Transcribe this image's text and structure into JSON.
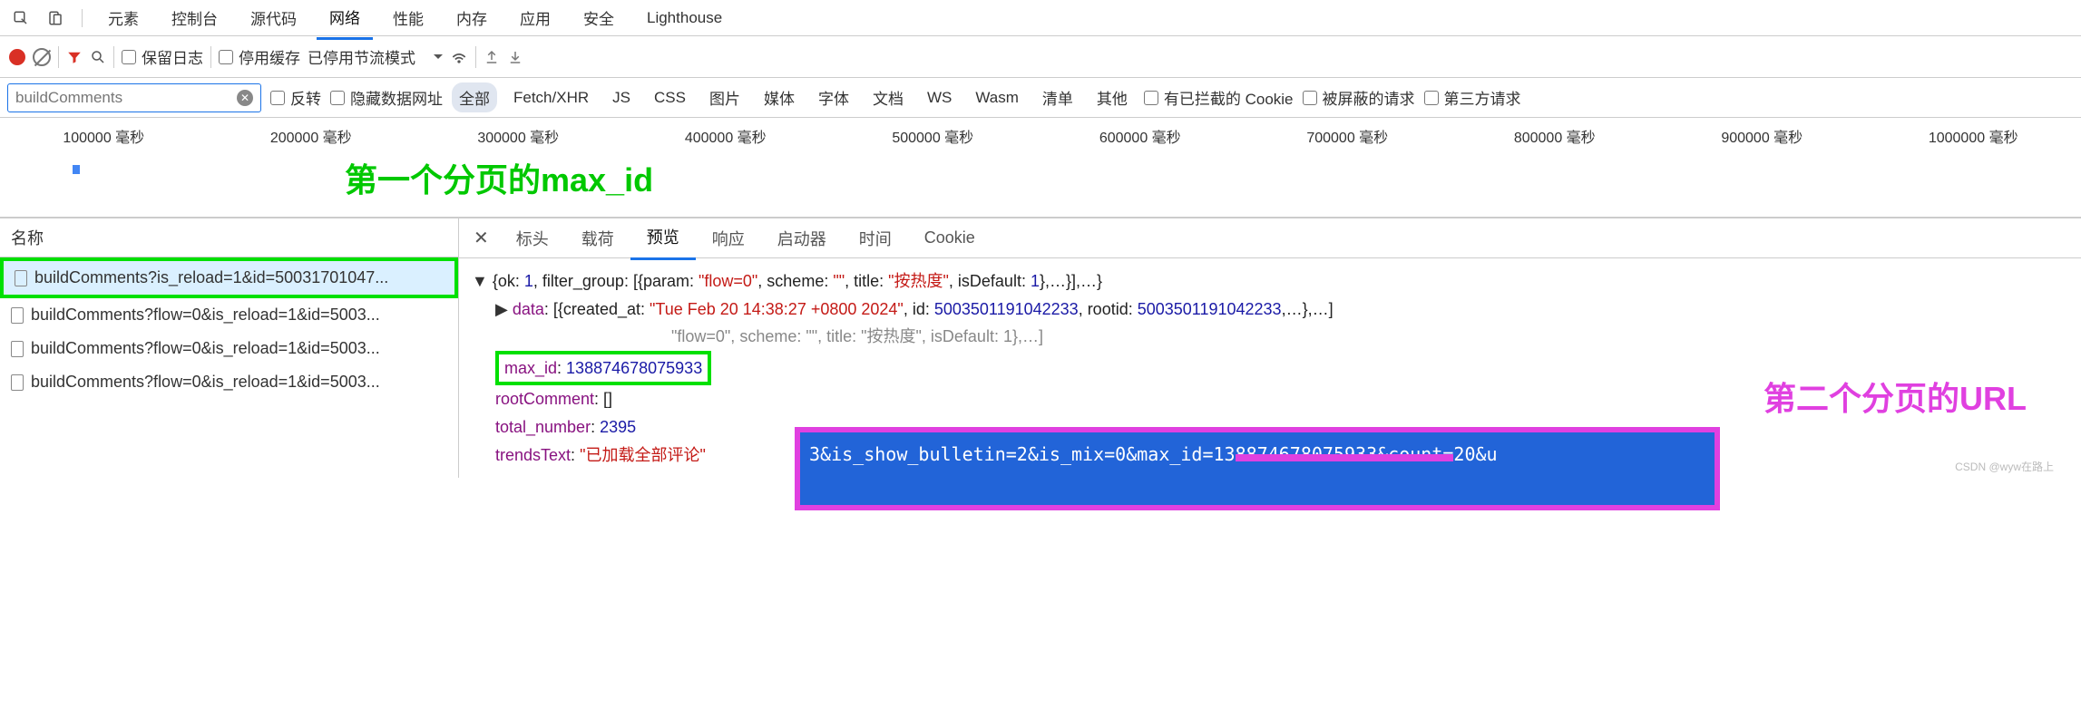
{
  "top_tabs": {
    "elements": "元素",
    "console": "控制台",
    "sources": "源代码",
    "network": "网络",
    "performance": "性能",
    "memory": "内存",
    "application": "应用",
    "security": "安全",
    "lighthouse": "Lighthouse"
  },
  "toolbar": {
    "preserve_log": "保留日志",
    "disable_cache": "停用缓存",
    "throttling": "已停用节流模式"
  },
  "filter_bar": {
    "input_value": "buildComments",
    "invert": "反转",
    "hide_data_urls": "隐藏数据网址",
    "all": "全部",
    "fetch_xhr": "Fetch/XHR",
    "js": "JS",
    "css": "CSS",
    "img": "图片",
    "media": "媒体",
    "font": "字体",
    "doc": "文档",
    "ws": "WS",
    "wasm": "Wasm",
    "manifest": "清单",
    "other": "其他",
    "blocked_cookies": "有已拦截的 Cookie",
    "blocked_requests": "被屏蔽的请求",
    "third_party": "第三方请求"
  },
  "timeline": {
    "labels": [
      "100000 毫秒",
      "200000 毫秒",
      "300000 毫秒",
      "400000 毫秒",
      "500000 毫秒",
      "600000 毫秒",
      "700000 毫秒",
      "800000 毫秒",
      "900000 毫秒",
      "1000000 毫秒"
    ]
  },
  "annotations": {
    "first_page_max_id": "第一个分页的max_id",
    "second_page_url": "第二个分页的URL"
  },
  "left_panel": {
    "name_header": "名称",
    "requests": [
      "buildComments?is_reload=1&id=50031701047...",
      "buildComments?flow=0&is_reload=1&id=5003...",
      "buildComments?flow=0&is_reload=1&id=5003...",
      "buildComments?flow=0&is_reload=1&id=5003..."
    ]
  },
  "detail_tabs": {
    "headers": "标头",
    "payload": "载荷",
    "preview": "预览",
    "response": "响应",
    "initiator": "启动器",
    "timing": "时间",
    "cookie": "Cookie"
  },
  "preview": {
    "line1_pre": "{ok: ",
    "line1_ok": "1",
    "line1_mid": ", filter_group: [{param: ",
    "line1_param": "\"flow=0\"",
    "line1_mid2": ", scheme: ",
    "line1_scheme": "\"\"",
    "line1_mid3": ", title: ",
    "line1_title": "\"按热度\"",
    "line1_mid4": ", isDefault: ",
    "line1_isdef": "1",
    "line1_end": "},…}],…}",
    "data_key": "data",
    "data_val_pre": ": [{created_at: ",
    "data_created": "\"Tue Feb 20 14:38:27 +0800 2024\"",
    "data_mid": ", id: ",
    "data_id": "5003501191042233",
    "data_mid2": ", rootid: ",
    "data_rootid": "5003501191042233",
    "data_end": ",…},…]",
    "filter_hidden": "\"flow=0\", scheme: \"\", title: \"按热度\", isDefault: 1},…]",
    "max_id_key": "max_id",
    "max_id_val": "138874678075933",
    "root_key": "rootComment",
    "root_val": ": []",
    "total_key": "total_number",
    "total_val": "2395",
    "trends_key": "trendsText",
    "trends_val": "\"已加载全部评论\""
  },
  "url_highlight": "3&is_show_bulletin=2&is_mix=0&max_id=138874678075933&count=20&u",
  "watermark": "CSDN @wyw在路上"
}
